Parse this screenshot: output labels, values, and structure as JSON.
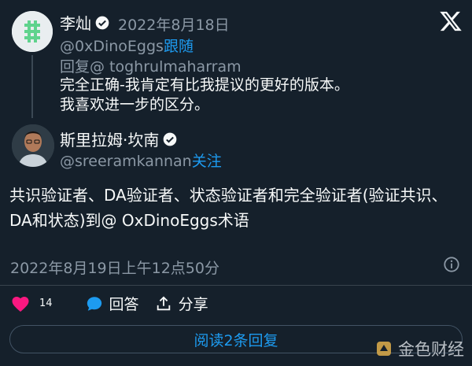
{
  "quoted": {
    "author_name": "李灿",
    "date": "2022年8月18日",
    "handle_prefix": "@0xDinoEggs",
    "handle_suffix": "跟随",
    "reply_to_prefix": "回复@ ",
    "reply_to_handle": "toghrulmaharram",
    "text_line1": "完全正确-我肯定有比我提议的更好的版本。",
    "text_line2": "我喜欢进一步的区分。"
  },
  "main": {
    "author_name": "斯里拉姆·坎南",
    "handle": "@sreeramkannan",
    "follow": "关注",
    "text": "共识验证者、DA验证者、状态验证者和完全验证者(验证共识、DA和状态)到@ OxDinoEggs术语",
    "timestamp": "2022年8月19日上午12点50分"
  },
  "actions": {
    "likes": "14",
    "reply_label": "回答",
    "share_label": "分享"
  },
  "read_replies_label": "阅读2条回复",
  "watermark_text": "金色财经",
  "colors": {
    "background": "#15202b",
    "accent": "#1d9bf0",
    "like": "#f91880",
    "muted": "#8b98a5"
  }
}
